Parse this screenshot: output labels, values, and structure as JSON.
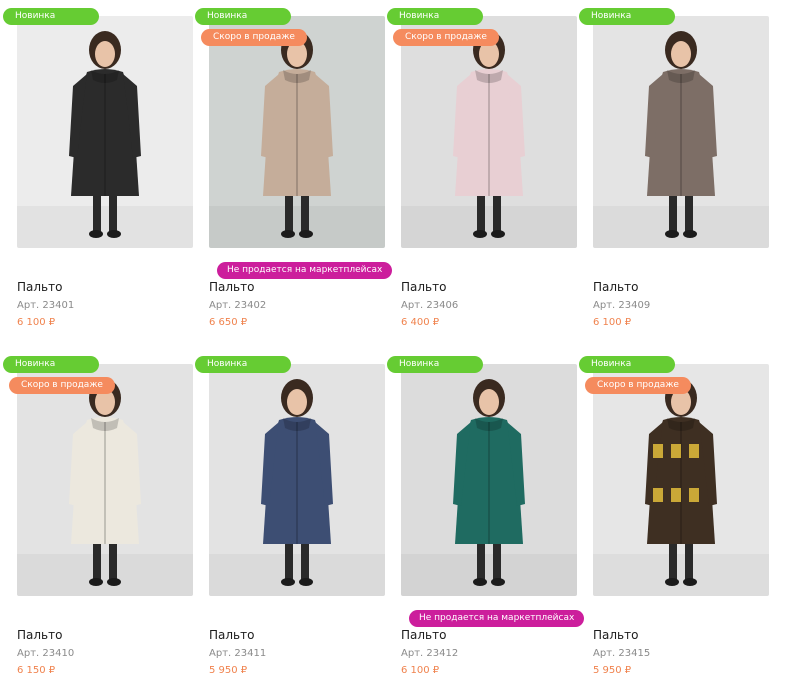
{
  "labels": {
    "new": "Новинка",
    "soon": "Скоро в продаже",
    "marketplace": "Не продается на маркетплейсах"
  },
  "products": [
    {
      "name": "Пальто",
      "sku": "Арт. 23401",
      "price": "6 100 ₽",
      "coat_color": "#2b2b2b",
      "bg_color": "#ececec",
      "is_new": true,
      "coming_soon": false,
      "not_on_marketplaces": false
    },
    {
      "name": "Пальто",
      "sku": "Арт. 23402",
      "price": "6 650 ₽",
      "coat_color": "#c5ad9a",
      "bg_color": "#cfd3d1",
      "is_new": true,
      "coming_soon": true,
      "not_on_marketplaces": true
    },
    {
      "name": "Пальто",
      "sku": "Арт. 23406",
      "price": "6 400 ₽",
      "coat_color": "#e8cfd3",
      "bg_color": "#dedede",
      "is_new": true,
      "coming_soon": true,
      "not_on_marketplaces": false
    },
    {
      "name": "Пальто",
      "sku": "Арт. 23409",
      "price": "6 100 ₽",
      "coat_color": "#7d6e66",
      "bg_color": "#e4e4e4",
      "is_new": true,
      "coming_soon": false,
      "not_on_marketplaces": false
    },
    {
      "name": "Пальто",
      "sku": "Арт. 23410",
      "price": "6 150 ₽",
      "coat_color": "#ece8de",
      "bg_color": "#e3e3e3",
      "is_new": true,
      "coming_soon": true,
      "not_on_marketplaces": false
    },
    {
      "name": "Пальто",
      "sku": "Арт. 23411",
      "price": "5 950 ₽",
      "coat_color": "#3d4e73",
      "bg_color": "#e3e3e3",
      "is_new": true,
      "coming_soon": false,
      "not_on_marketplaces": false
    },
    {
      "name": "Пальто",
      "sku": "Арт. 23412",
      "price": "6 100 ₽",
      "coat_color": "#1f6b61",
      "bg_color": "#dcdcdc",
      "is_new": true,
      "coming_soon": false,
      "not_on_marketplaces": true
    },
    {
      "name": "Пальто",
      "sku": "Арт. 23415",
      "price": "5 950 ₽",
      "coat_color": "#3e2f22",
      "bg_color": "#e6e6e6",
      "is_new": true,
      "coming_soon": true,
      "not_on_marketplaces": false
    }
  ],
  "colors": {
    "new_badge": "#66cc33",
    "soon_badge": "#f58b5e",
    "marketplace_badge": "#cc1e9c",
    "price": "#f0834e",
    "sku": "#8a8a8a"
  }
}
